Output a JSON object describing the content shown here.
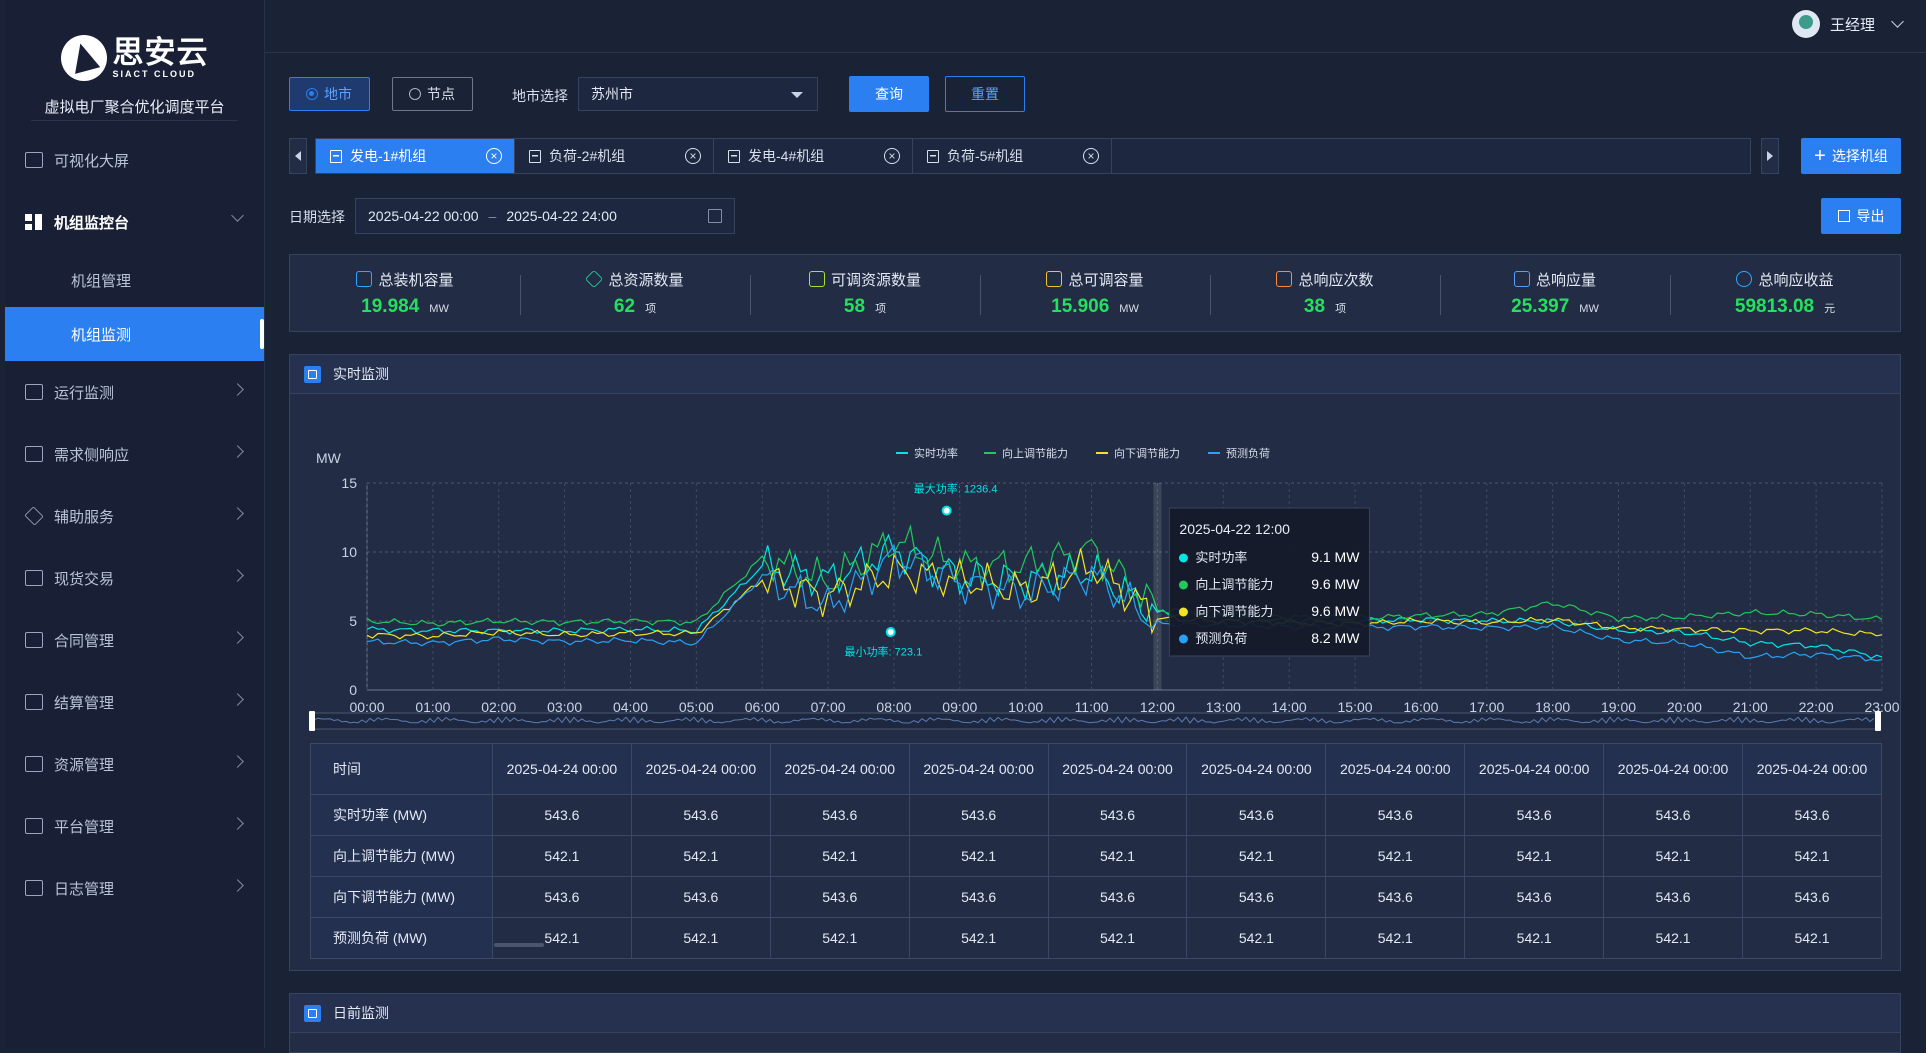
{
  "sidebar": {
    "logo_cn": "思安云",
    "logo_en": "SIACT CLOUD",
    "subtitle": "虚拟电厂聚合优化调度平台",
    "items": [
      {
        "label": "可视化大屏"
      },
      {
        "label": "机组监控台"
      },
      {
        "label": "运行监测"
      },
      {
        "label": "需求侧响应"
      },
      {
        "label": "辅助服务"
      },
      {
        "label": "现货交易"
      },
      {
        "label": "合同管理"
      },
      {
        "label": "结算管理"
      },
      {
        "label": "资源管理"
      },
      {
        "label": "平台管理"
      },
      {
        "label": "日志管理"
      }
    ],
    "sub_items": [
      {
        "label": "机组管理"
      },
      {
        "label": "机组监测"
      }
    ]
  },
  "header": {
    "user_name": "王经理"
  },
  "filters": {
    "radio_city": "地市",
    "radio_node": "节点",
    "city_label": "地市选择",
    "city_value": "苏州市",
    "query_button": "查询",
    "reset_button": "重置",
    "select_unit_button": "选择机组",
    "export_button": "导出",
    "date_label": "日期选择",
    "date_start": "2025-04-22 00:00",
    "date_sep": "–",
    "date_end": "2025-04-22 24:00"
  },
  "tabs": [
    {
      "label": "发电-1#机组"
    },
    {
      "label": "负荷-2#机组"
    },
    {
      "label": "发电-4#机组"
    },
    {
      "label": "负荷-5#机组"
    }
  ],
  "stats": [
    {
      "title": "总装机容量",
      "value": "19.984",
      "unit": "MW",
      "icon": "monitor-icon"
    },
    {
      "title": "总资源数量",
      "value": "62",
      "unit": "项",
      "icon": "layers-icon"
    },
    {
      "title": "可调资源数量",
      "value": "58",
      "unit": "项",
      "icon": "inbox-icon"
    },
    {
      "title": "总可调容量",
      "value": "15.906",
      "unit": "MW",
      "icon": "calendar-icon"
    },
    {
      "title": "总响应次数",
      "value": "38",
      "unit": "项",
      "icon": "document-icon"
    },
    {
      "title": "总响应量",
      "value": "25.397",
      "unit": "MW",
      "icon": "report-icon"
    },
    {
      "title": "总响应收益",
      "value": "59813.08",
      "unit": "元",
      "icon": "user-coin-icon"
    }
  ],
  "colors": {
    "accent": "#2b7ff0",
    "stat_value": "#24e05e",
    "series_realtime": "#00e5e5",
    "series_up": "#21c85a",
    "series_down": "#f2e422",
    "series_forecast": "#2aa0f5"
  },
  "realtime_panel": {
    "title": "实时监测"
  },
  "day_ahead_panel": {
    "title": "日前监测"
  },
  "chart_data": {
    "type": "line",
    "ylabel": "MW",
    "ylim": [
      0,
      15
    ],
    "yticks": [
      0,
      5,
      10,
      15
    ],
    "x": [
      "00:00",
      "01:00",
      "02:00",
      "03:00",
      "04:00",
      "05:00",
      "06:00",
      "07:00",
      "08:00",
      "09:00",
      "10:00",
      "11:00",
      "12:00",
      "13:00",
      "14:00",
      "15:00",
      "16:00",
      "17:00",
      "18:00",
      "19:00",
      "20:00",
      "21:00",
      "22:00",
      "23:00"
    ],
    "series": [
      {
        "name": "实时功率",
        "values": [
          4.4,
          4.3,
          4.3,
          4.3,
          4.4,
          4.3,
          9.0,
          8.0,
          10.2,
          8.2,
          8.0,
          8.6,
          5.6,
          5.3,
          5.0,
          5.0,
          5.1,
          5.0,
          5.0,
          4.3,
          4.2,
          3.4,
          3.2,
          2.4
        ]
      },
      {
        "name": "向上调节能力",
        "values": [
          5.0,
          4.8,
          5.0,
          4.9,
          5.0,
          4.9,
          9.6,
          7.8,
          10.8,
          9.0,
          9.0,
          10.2,
          5.8,
          5.6,
          5.3,
          5.2,
          5.4,
          5.5,
          6.3,
          5.2,
          5.3,
          5.6,
          5.5,
          5.1
        ]
      },
      {
        "name": "向下调节能力",
        "values": [
          4.0,
          3.9,
          4.2,
          4.0,
          4.1,
          4.1,
          8.0,
          6.8,
          8.6,
          8.0,
          7.2,
          9.0,
          5.2,
          5.0,
          4.9,
          4.8,
          5.0,
          4.9,
          5.1,
          4.5,
          4.4,
          4.3,
          4.3,
          4.0
        ]
      },
      {
        "name": "预测负荷",
        "values": [
          3.5,
          3.4,
          3.7,
          3.5,
          3.6,
          3.4,
          8.2,
          6.0,
          9.6,
          7.8,
          7.0,
          8.4,
          4.8,
          4.7,
          4.6,
          4.5,
          4.6,
          4.5,
          4.6,
          3.6,
          3.4,
          2.4,
          2.6,
          2.2
        ]
      }
    ],
    "annotations": {
      "max_label": "最大功率:",
      "max_value": "1236.4",
      "min_label": "最小功率:",
      "min_value": "723.1"
    },
    "tooltip": {
      "time": "2025-04-22  12:00",
      "rows": [
        {
          "name": "实时功率",
          "value": "9.1 MW"
        },
        {
          "name": "向上调节能力",
          "value": "9.6 MW"
        },
        {
          "name": "向下调节能力",
          "value": "9.6 MW"
        },
        {
          "name": "预测负荷",
          "value": "8.2 MW"
        }
      ]
    },
    "legend_position": "top-center",
    "grid": true
  },
  "table": {
    "header_label": "时间",
    "times": [
      "2025-04-24 00:00",
      "2025-04-24 00:00",
      "2025-04-24 00:00",
      "2025-04-24 00:00",
      "2025-04-24 00:00",
      "2025-04-24 00:00",
      "2025-04-24 00:00",
      "2025-04-24 00:00",
      "2025-04-24 00:00",
      "2025-04-24 00:00"
    ],
    "rows": [
      {
        "label": "实时功率 (MW)",
        "values": [
          "543.6",
          "543.6",
          "543.6",
          "543.6",
          "543.6",
          "543.6",
          "543.6",
          "543.6",
          "543.6",
          "543.6"
        ]
      },
      {
        "label": "向上调节能力 (MW)",
        "values": [
          "542.1",
          "542.1",
          "542.1",
          "542.1",
          "542.1",
          "542.1",
          "542.1",
          "542.1",
          "542.1",
          "542.1"
        ]
      },
      {
        "label": "向下调节能力 (MW)",
        "values": [
          "543.6",
          "543.6",
          "543.6",
          "543.6",
          "543.6",
          "543.6",
          "543.6",
          "543.6",
          "543.6",
          "543.6"
        ]
      },
      {
        "label": "预测负荷 (MW)",
        "values": [
          "542.1",
          "542.1",
          "542.1",
          "542.1",
          "542.1",
          "542.1",
          "542.1",
          "542.1",
          "542.1",
          "542.1"
        ]
      }
    ]
  }
}
